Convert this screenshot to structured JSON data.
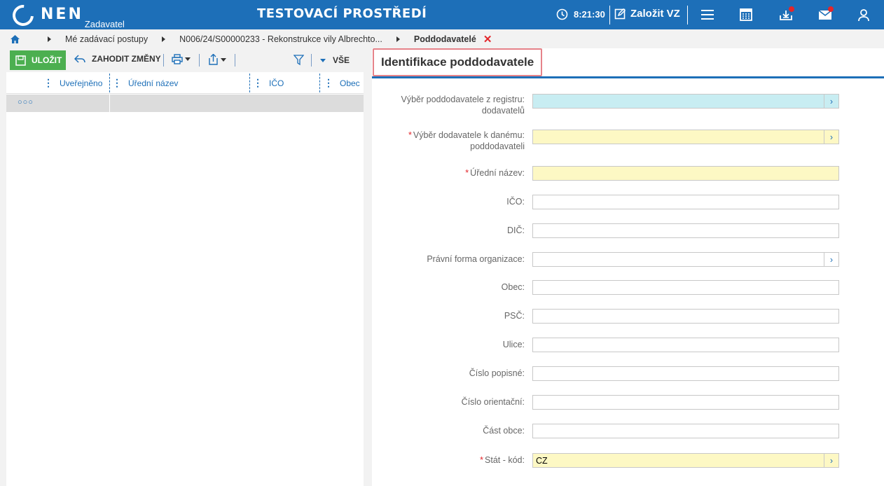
{
  "header": {
    "logo_text": "NEN",
    "logo_sub": "Zadavatel",
    "env_title": "TESTOVACÍ PROSTŘEDÍ",
    "clock": "8:21:30",
    "new_vz_label": "Založit VZ",
    "accent_color": "#1d6fb8",
    "notification_color": "#e3262b"
  },
  "breadcrumb": {
    "items": [
      {
        "label": "Mé zadávací postupy"
      },
      {
        "label": "N006/24/S00000233 - Rekonstrukce vily Albrechto..."
      },
      {
        "label": "Poddodavatelé"
      }
    ]
  },
  "toolbar": {
    "save_label": "ULOŽIT",
    "discard_label": "ZAHODIT ZMĚNY",
    "all_label": "VŠE"
  },
  "grid": {
    "columns": [
      {
        "label": "Uveřejněno"
      },
      {
        "label": "Úřední název"
      },
      {
        "label": "IČO"
      },
      {
        "label": "Obec"
      }
    ],
    "filter_placeholder": "○○○"
  },
  "form": {
    "title": "Identifikace poddodavatele",
    "fields": [
      {
        "label_line1": "Výběr poddodavatele z registru:",
        "label_line2": "dodavatelů",
        "value": "",
        "required": false
      },
      {
        "label_line1": "Výběr dodavatele k danému:",
        "label_line2": "poddodavateli",
        "value": "",
        "required": true
      },
      {
        "label_line1": "Úřední název:",
        "value": "",
        "required": true
      },
      {
        "label_line1": "IČO:",
        "value": ""
      },
      {
        "label_line1": "DIČ:",
        "value": ""
      },
      {
        "label_line1": "Právní forma organizace:",
        "value": ""
      },
      {
        "label_line1": "Obec:",
        "value": ""
      },
      {
        "label_line1": "PSČ:",
        "value": ""
      },
      {
        "label_line1": "Ulice:",
        "value": ""
      },
      {
        "label_line1": "Číslo popisné:",
        "value": ""
      },
      {
        "label_line1": "Číslo orientační:",
        "value": ""
      },
      {
        "label_line1": "Část obce:",
        "value": ""
      },
      {
        "label_line1": "Stát - kód:",
        "value": "CZ",
        "required": true
      }
    ]
  }
}
